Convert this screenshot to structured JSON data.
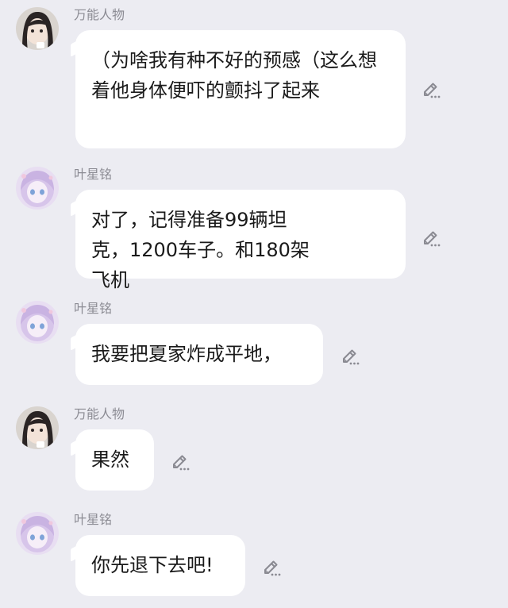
{
  "messages": [
    {
      "sender": "万能人物",
      "avatar": "girl-photo-avatar",
      "text": "（为啥我有种不好的预感（这么想着他身体便吓的颤抖了起来",
      "action_icon": "edit-icon"
    },
    {
      "sender": "叶星铭",
      "avatar": "anime-girl-avatar",
      "text": "对了，记得准备99辆坦克，1200车子。和180架飞机",
      "action_icon": "edit-icon"
    },
    {
      "sender": "叶星铭",
      "avatar": "anime-girl-avatar",
      "text": "我要把夏家炸成平地，",
      "action_icon": "edit-icon"
    },
    {
      "sender": "万能人物",
      "avatar": "girl-photo-avatar",
      "text": "果然",
      "action_icon": "edit-icon"
    },
    {
      "sender": "叶星铭",
      "avatar": "anime-girl-avatar",
      "text": "你先退下去吧!",
      "action_icon": "edit-icon"
    }
  ],
  "colors": {
    "background": "#ececf2",
    "bubble": "#ffffff",
    "name": "#8c8c94",
    "text": "#1a1a1a",
    "icon": "#8a8a92"
  }
}
